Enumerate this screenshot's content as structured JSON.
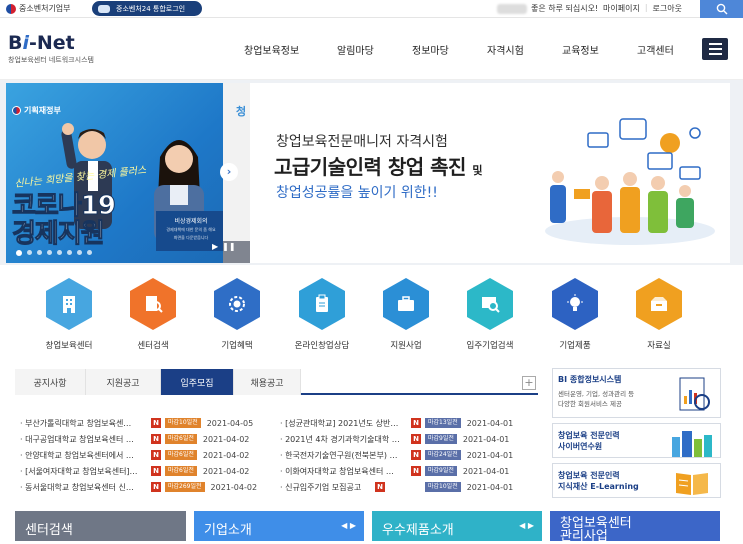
{
  "topbar": {
    "ministry": "중소벤처기업부",
    "integrated_login": "중소벤처24 통합로그인",
    "greeting": "좋은 하루 되십시오!",
    "links": [
      "마이페이지",
      "로그아웃"
    ]
  },
  "header": {
    "logo": "Bi-Net",
    "logo_sub": "창업보육센터 네트워크시스템",
    "nav": [
      "창업보육정보",
      "알림마당",
      "정보마당",
      "자격시험",
      "교육정보",
      "고객센터"
    ]
  },
  "hero_left": {
    "ministry": "기획재정부",
    "slogan": "신나는 희망을 찾는 경제 플러스",
    "title_line1": "코로나19",
    "title_line2": "경제지원",
    "sign_title": "비상경제회의",
    "sign_sub": "경제대책에 대한 문의 좀 해요",
    "sign_sub2": "화면을 다운받읍니다"
  },
  "hero_right": {
    "line1": "창업보육전문매니저 자격시험",
    "line2": "고급기술인력 창업 촉진",
    "line2_suffix": "및",
    "line3": "창업성공률을 높이기 위한!!"
  },
  "quick_icons": [
    {
      "label": "창업보육센터",
      "icon": "building-icon",
      "color": "#47a6e0"
    },
    {
      "label": "센터검색",
      "icon": "search-doc-icon",
      "color": "#f0732a"
    },
    {
      "label": "기업혜택",
      "icon": "gear-badge-icon",
      "color": "#2f6ec6"
    },
    {
      "label": "온라인창업상담",
      "icon": "clipboard-icon",
      "color": "#2f9fd8"
    },
    {
      "label": "지원사업",
      "icon": "briefcase-icon",
      "color": "#2b8fd6"
    },
    {
      "label": "입주기업검색",
      "icon": "magnifier-icon",
      "color": "#2cb8c8"
    },
    {
      "label": "기업제품",
      "icon": "lightbulb-icon",
      "color": "#2d62c2"
    },
    {
      "label": "자료실",
      "icon": "archive-box-icon",
      "color": "#f0a020"
    }
  ],
  "tabs": [
    "공지사항",
    "지원공고",
    "입주모집",
    "채용공고"
  ],
  "active_tab": "입주모집",
  "notices_left": [
    {
      "title": "· 부산가톨릭대학교 창업보육센…",
      "dday": "마감10일전",
      "date": "2021-04-05",
      "color": "orange"
    },
    {
      "title": "· 대구공업대학교 창업보육센터 …",
      "dday": "마감6일전",
      "date": "2021-04-02",
      "color": "orange"
    },
    {
      "title": "· 안양대학교 창업보육센터에서 …",
      "dday": "마감6일전",
      "date": "2021-04-02",
      "color": "orange"
    },
    {
      "title": "· [서울여자대학교 창업보육센터]…",
      "dday": "마감6일전",
      "date": "2021-04-02",
      "color": "orange"
    },
    {
      "title": "· 동서울대학교 창업보육센터 신…",
      "dday": "마감269일전",
      "date": "2021-04-02",
      "color": "orange"
    }
  ],
  "notices_right": [
    {
      "title": "· [성균관대학교] 2021년도 상반…",
      "dday": "마감13일전",
      "date": "2021-04-01"
    },
    {
      "title": "· 2021년 4차 경기과학기술대학 …",
      "dday": "마감9일전",
      "date": "2021-04-01"
    },
    {
      "title": "· 한국전자기술연구원(전북본부) …",
      "dday": "마감24일전",
      "date": "2021-04-01"
    },
    {
      "title": "· 이화여자대학교 창업보육센터 …",
      "dday": "마감9일전",
      "date": "2021-04-01"
    },
    {
      "title": "· 신규입주기업 모집공고",
      "dday": "마감10일전",
      "date": "2021-04-01"
    }
  ],
  "new_badge": "N",
  "side_boxes": [
    {
      "title": "BI 종합정보시스템",
      "desc1": "센터운영, 기업, 성과관리 등",
      "desc2": "다양한 회원서비스 제공"
    },
    {
      "title": "창업보육 전문인력",
      "desc1": "사이버연수원",
      "desc2": ""
    },
    {
      "title": "창업보육 전문인력",
      "desc1": "지식재산 E-Learning",
      "desc2": ""
    }
  ],
  "bottom_tiles": [
    {
      "label": "센터검색",
      "color": "#6f7786"
    },
    {
      "label": "기업소개",
      "color": "#3f8ee8"
    },
    {
      "label": "우수제품소개",
      "color": "#2fb2c8"
    },
    {
      "label": "창업보육센터",
      "color": "#3c66c8"
    }
  ],
  "bottom_last_sub": "관리사업"
}
